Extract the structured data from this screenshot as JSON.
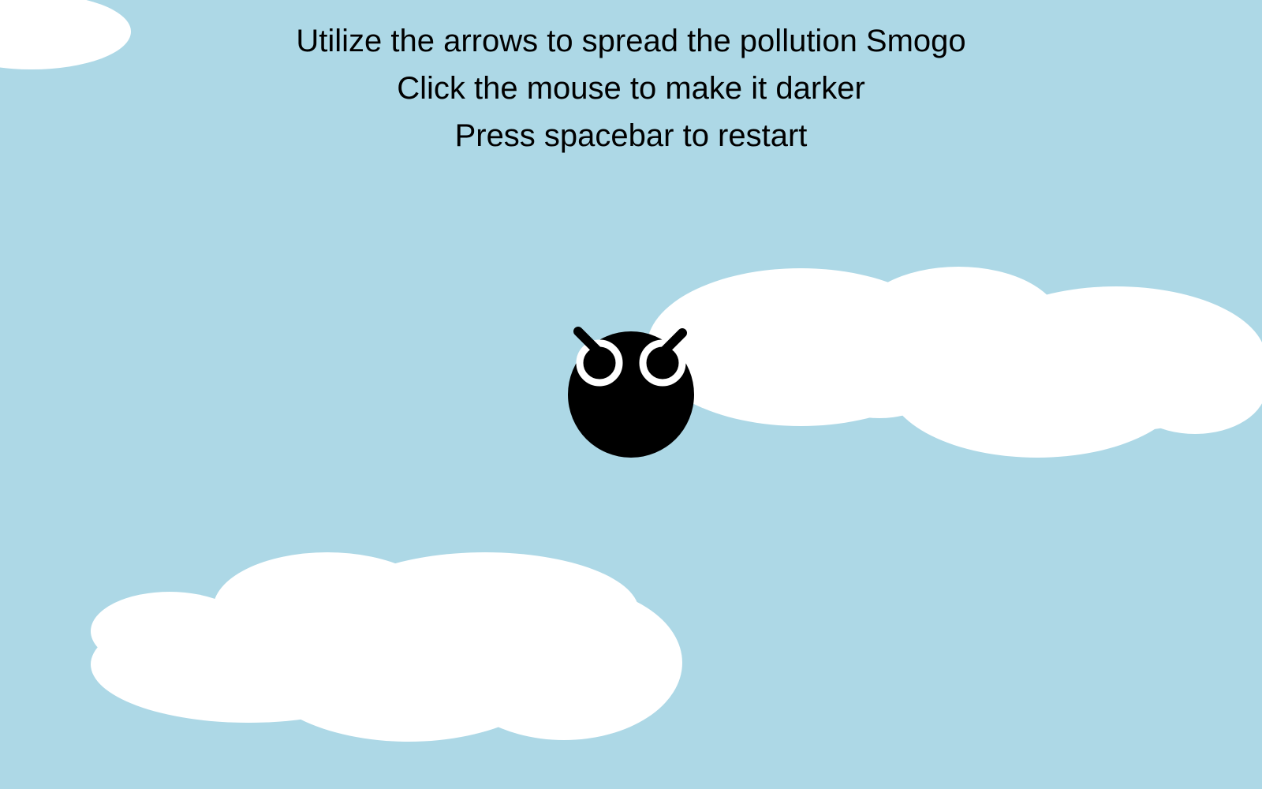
{
  "instructions": {
    "line1": "Utilize the arrows to spread the pollution Smogo",
    "line2": "Click the mouse to make it darker",
    "line3": "Press spacebar to restart"
  },
  "scene": {
    "sky_color": "#add8e6",
    "cloud_color": "#ffffff",
    "character": {
      "name": "Smogo",
      "body_color": "#000000",
      "eye_color": "#ffffff"
    }
  }
}
